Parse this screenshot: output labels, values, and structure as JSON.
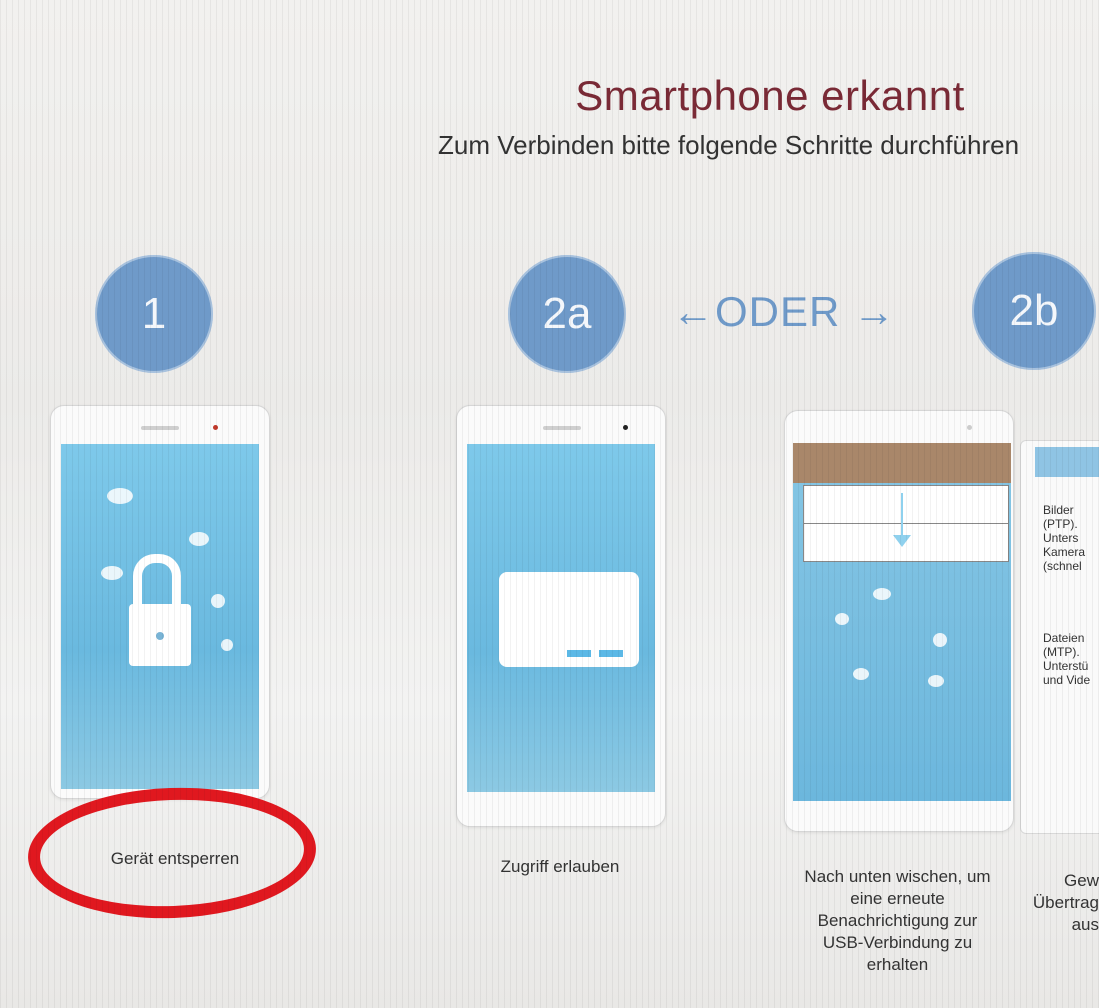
{
  "header": {
    "title": "Smartphone erkannt",
    "subtitle": "Zum Verbinden bitte folgende Schritte durchführen"
  },
  "steps": [
    {
      "number": "1",
      "label": "Gerät entsperren"
    },
    {
      "number": "2a",
      "label": "Zugriff erlauben"
    },
    {
      "number": "2b",
      "label": "Nach unten wischen, um eine erneute Benachrichtigung zur USB-Verbindung zu erhalten"
    }
  ],
  "separator": "←ODER →",
  "side_card": {
    "option1": "Bilder\n(PTP).\nUnters\nKamera\n(schnel",
    "option2": "Dateien\n(MTP).\nUnterstü\nund Vide",
    "caption": "Gew\nÜbertrag\naus"
  },
  "colors": {
    "title": "#7a2a36",
    "step_circle": "#6f9ac9",
    "annotation_ring": "#e0181f"
  }
}
